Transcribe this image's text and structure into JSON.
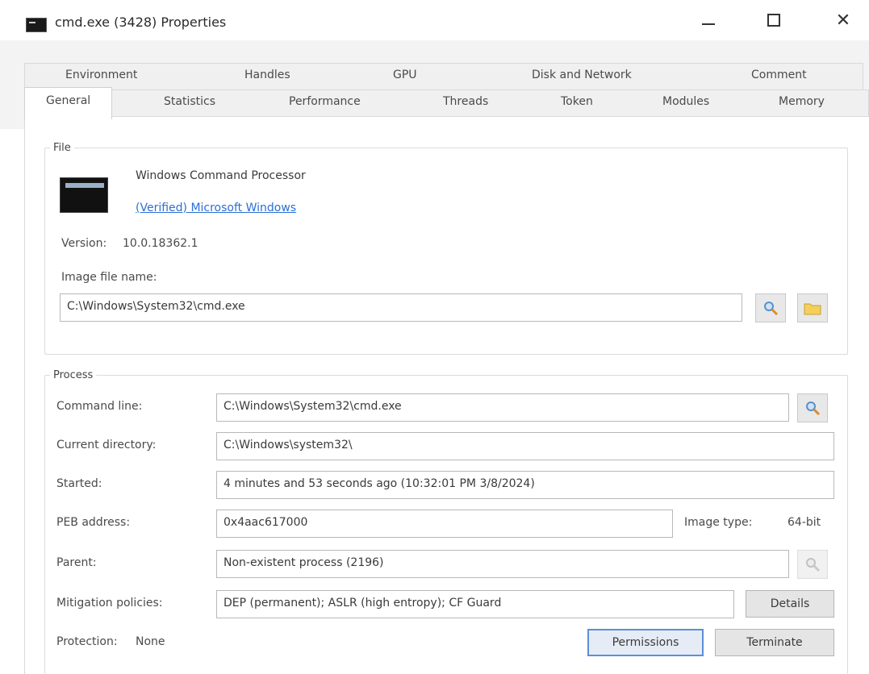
{
  "window": {
    "title": "cmd.exe (3428) Properties",
    "minimize_label": "",
    "maximize_label": "",
    "close_label": "✕"
  },
  "tabs": {
    "row1": [
      "Environment",
      "Handles",
      "GPU",
      "Disk and Network",
      "Comment"
    ],
    "row2": [
      "General",
      "Statistics",
      "Performance",
      "Threads",
      "Token",
      "Modules",
      "Memory"
    ],
    "active": "General"
  },
  "file": {
    "group_label": "File",
    "description": "Windows Command Processor",
    "verified": "(Verified) Microsoft Windows",
    "version_label": "Version:",
    "version": "10.0.18362.1",
    "image_file_label": "Image file name:",
    "image_file": "C:\\Windows\\System32\\cmd.exe"
  },
  "process": {
    "group_label": "Process",
    "command_line_label": "Command line:",
    "command_line": "C:\\Windows\\System32\\cmd.exe",
    "current_dir_label": "Current directory:",
    "current_dir": "C:\\Windows\\system32\\",
    "started_label": "Started:",
    "started": "4 minutes and 53 seconds ago (10:32:01 PM 3/8/2024)",
    "peb_label": "PEB address:",
    "peb": "0x4aac617000",
    "image_type_label": "Image type:",
    "image_type": "64-bit",
    "parent_label": "Parent:",
    "parent": "Non-existent process (2196)",
    "mitigation_label": "Mitigation policies:",
    "mitigation": "DEP (permanent); ASLR (high entropy); CF Guard",
    "details_label": "Details",
    "protection_label": "Protection:",
    "protection": "None",
    "permissions_label": "Permissions",
    "terminate_label": "Terminate"
  }
}
